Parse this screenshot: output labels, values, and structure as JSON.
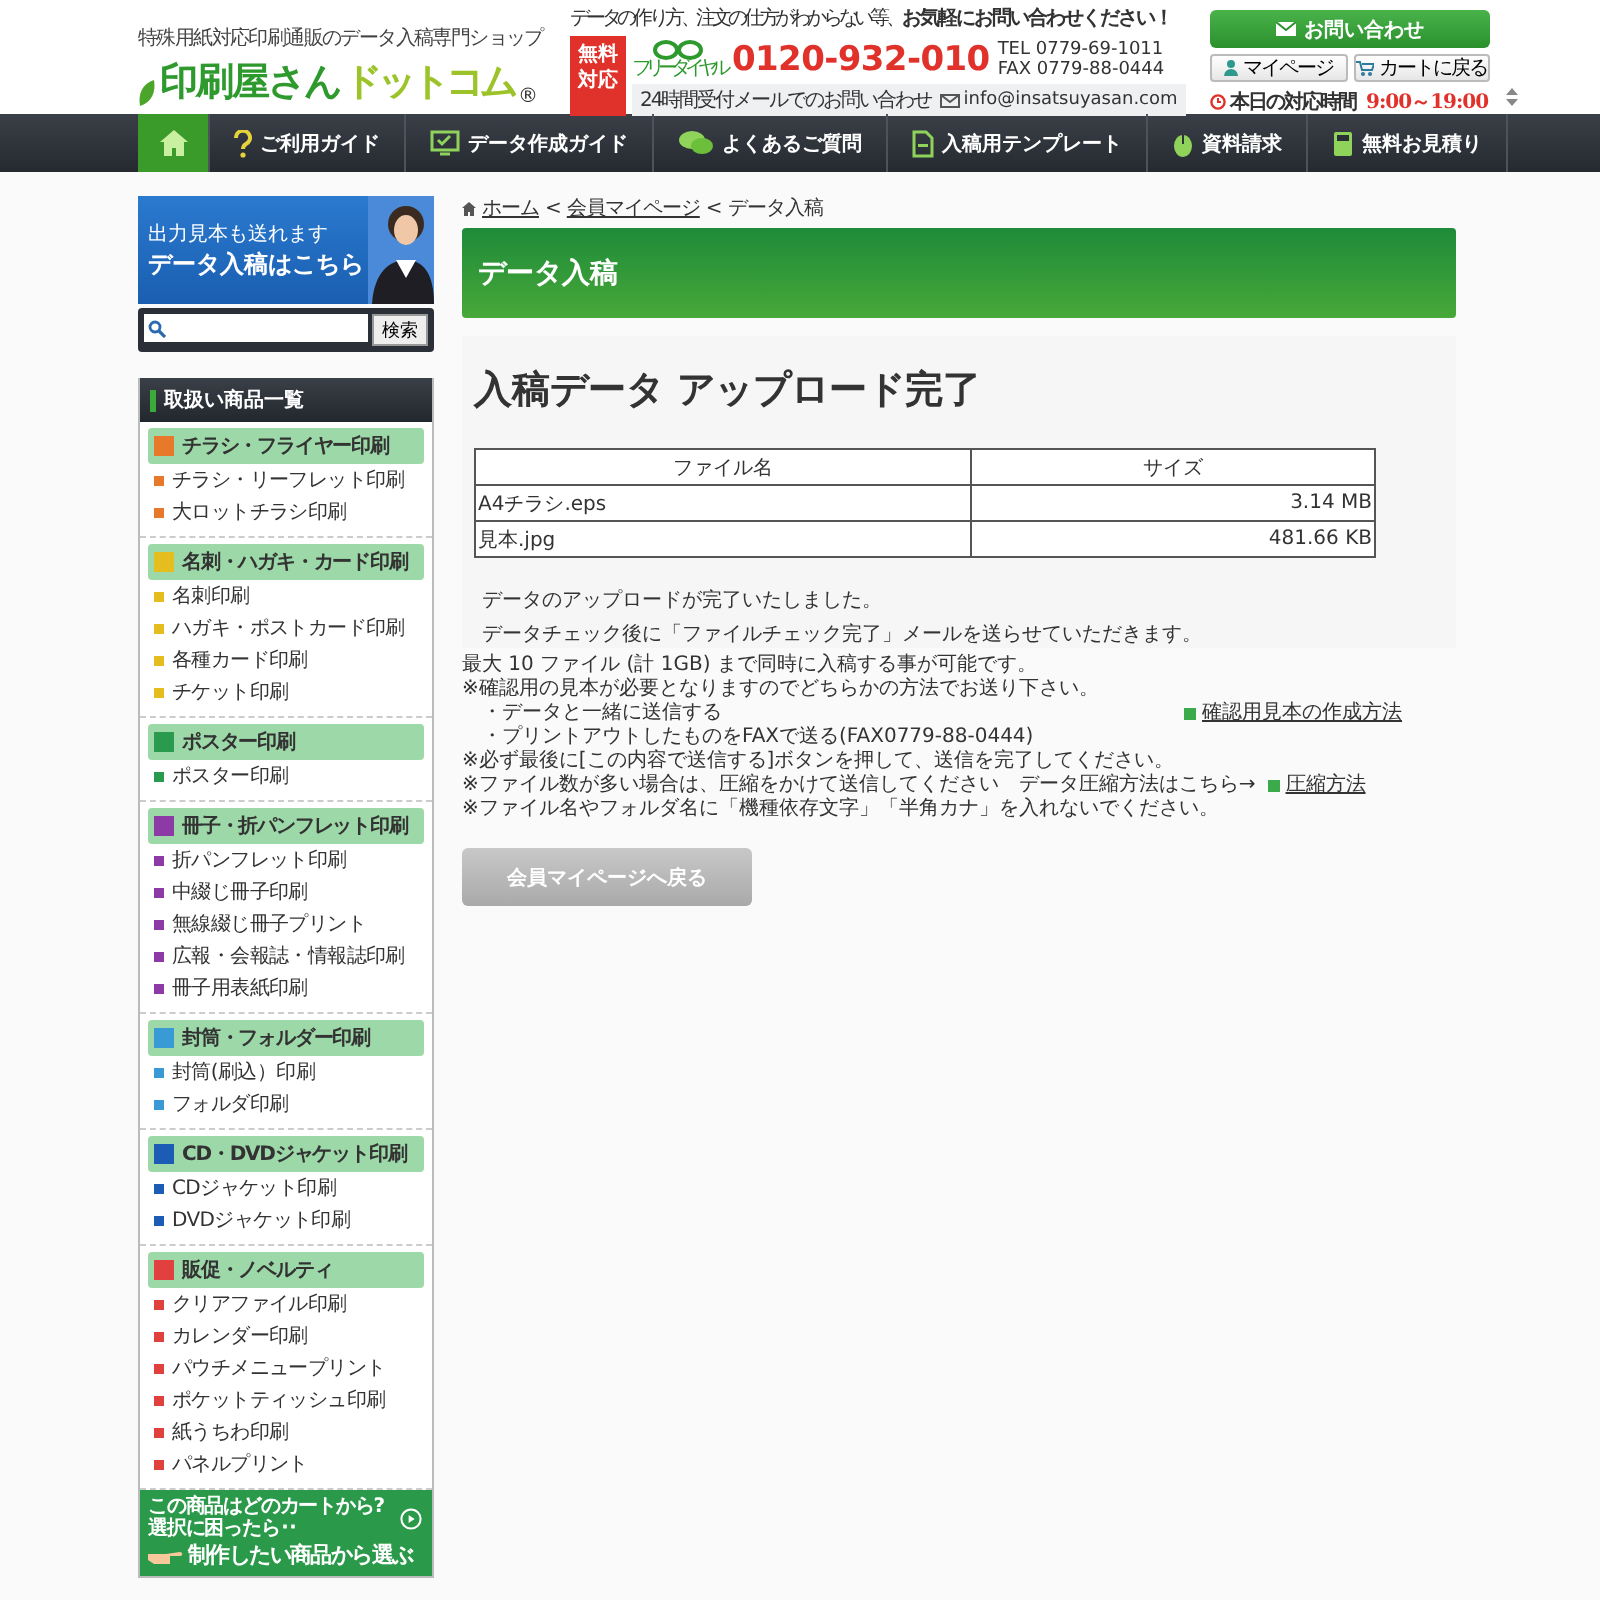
{
  "header": {
    "tagline": "特殊用紙対応印刷通販のデータ入稿専門ショップ",
    "logo_main": "印刷屋さん",
    "logo_accent": "ドットコム",
    "logo_mark": "®",
    "contact_lead": "データの作り方、注文の仕方がわからない等、",
    "contact_lead_big": "お気軽にお問い合わせください！",
    "free_badge": "無料対応",
    "freedial_label": "フリーダイヤル",
    "freedial": "0120-932-010",
    "tel": "TEL 0779-69-1011",
    "fax": "FAX 0779-88-0444",
    "mail_note": "24時間受付メールでのお問い合わせ",
    "email": "info@insatsuyasan.com",
    "contact_button": "お問い合わせ",
    "mypage_button": "マイページ",
    "cart_button": "カートに戻る",
    "hours_label": "本日の対応時間",
    "hours": "9:00～19:00"
  },
  "nav": [
    {
      "selected": true
    },
    {
      "label": "ご利用ガイド",
      "selected": false
    },
    {
      "label": "データ作成ガイド",
      "selected": false
    },
    {
      "label": "よくあるご質問",
      "selected": false
    },
    {
      "label": "入稿用テンプレート",
      "selected": false
    },
    {
      "label": "資料請求",
      "selected": false
    },
    {
      "label": "無料お見積り",
      "selected": false
    }
  ],
  "sidebar": {
    "banner": {
      "line_1": "出力見本も送れます",
      "line_2": "データ入稿はこちら"
    },
    "search": {
      "button": "検索"
    },
    "title": "取扱い商品一覧",
    "categories": [
      {
        "name": "チラシ・フライヤー印刷",
        "color": "#e8792a",
        "items": [
          "チラシ・リーフレット印刷",
          "大ロットチラシ印刷"
        ]
      },
      {
        "name": "名刺・ハガキ・カード印刷",
        "color": "#e6bd1e",
        "items": [
          "名刺印刷",
          "ハガキ・ポストカード印刷",
          "各種カード印刷",
          "チケット印刷"
        ]
      },
      {
        "name": "ポスター印刷",
        "color": "#2a9a4e",
        "items": [
          "ポスター印刷"
        ]
      },
      {
        "name": "冊子・折パンフレット印刷",
        "color": "#8e3aa6",
        "items": [
          "折パンフレット印刷",
          "中綴じ冊子印刷",
          "無線綴じ冊子プリント",
          "広報・会報誌・情報誌印刷",
          "冊子用表紙印刷"
        ]
      },
      {
        "name": "封筒・フォルダー印刷",
        "color": "#3a9ad6",
        "items": [
          "封筒(刷込）印刷",
          "フォルダ印刷"
        ]
      },
      {
        "name": "CD・DVDジャケット印刷",
        "color": "#1c5cb4",
        "items": [
          "CDジャケット印刷",
          "DVDジャケット印刷"
        ]
      },
      {
        "name": "販促・ノベルティ",
        "color": "#e2403e",
        "items": [
          "クリアファイル印刷",
          "カレンダー印刷",
          "パウチメニュープリント",
          "ポケットティッシュ印刷",
          "紙うちわ印刷",
          "パネルプリント"
        ]
      }
    ],
    "helper": {
      "line_1": "この商品はどのカートから?",
      "line_2": "選択に困ったら･･",
      "link": "制作したい商品から選ぶ"
    }
  },
  "main": {
    "breadcrumb": [
      {
        "label": "ホーム",
        "link": true
      },
      {
        "label": "会員マイページ",
        "link": true
      },
      {
        "label": "データ入稿",
        "link": false
      }
    ],
    "breadcrumb_sep": "<",
    "page_title": "データ入稿",
    "heading": "入稿データ アップロード完了",
    "table": {
      "columns": [
        "ファイル名",
        "サイズ"
      ],
      "rows": [
        [
          "A4チラシ.eps",
          "3.14 MB"
        ],
        [
          "見本.jpg",
          "481.66 KB"
        ]
      ]
    },
    "messages": [
      "データのアップロードが完了いたしました。",
      "データチェック後に「ファイルチェック完了」メールを送らせていただきます。"
    ],
    "notes": [
      {
        "text": "最大 10 ファイル (計 1GB) まで同時に入稿する事が可能です。"
      },
      {
        "text": "※確認用の見本が必要となりますのでどちらかの方法でお送り下さい。"
      },
      {
        "text": "　・データと一緒に送信する",
        "link": "確認用見本の作成方法"
      },
      {
        "text": "　・プリントアウトしたものをFAXで送る(FAX0779-88-0444)"
      },
      {
        "text": "※必ず最後に[この内容で送信する]ボタンを押して、送信を完了してください。"
      },
      {
        "text": "※ファイル数が多い場合は、圧縮をかけて送信してください　データ圧縮方法はこちら→",
        "link": "圧縮方法"
      },
      {
        "text": "※ファイル名やフォルダ名に「機種依存文字」「半角カナ」を入れないでください。"
      }
    ],
    "back_button": "会員マイページへ戻る"
  }
}
